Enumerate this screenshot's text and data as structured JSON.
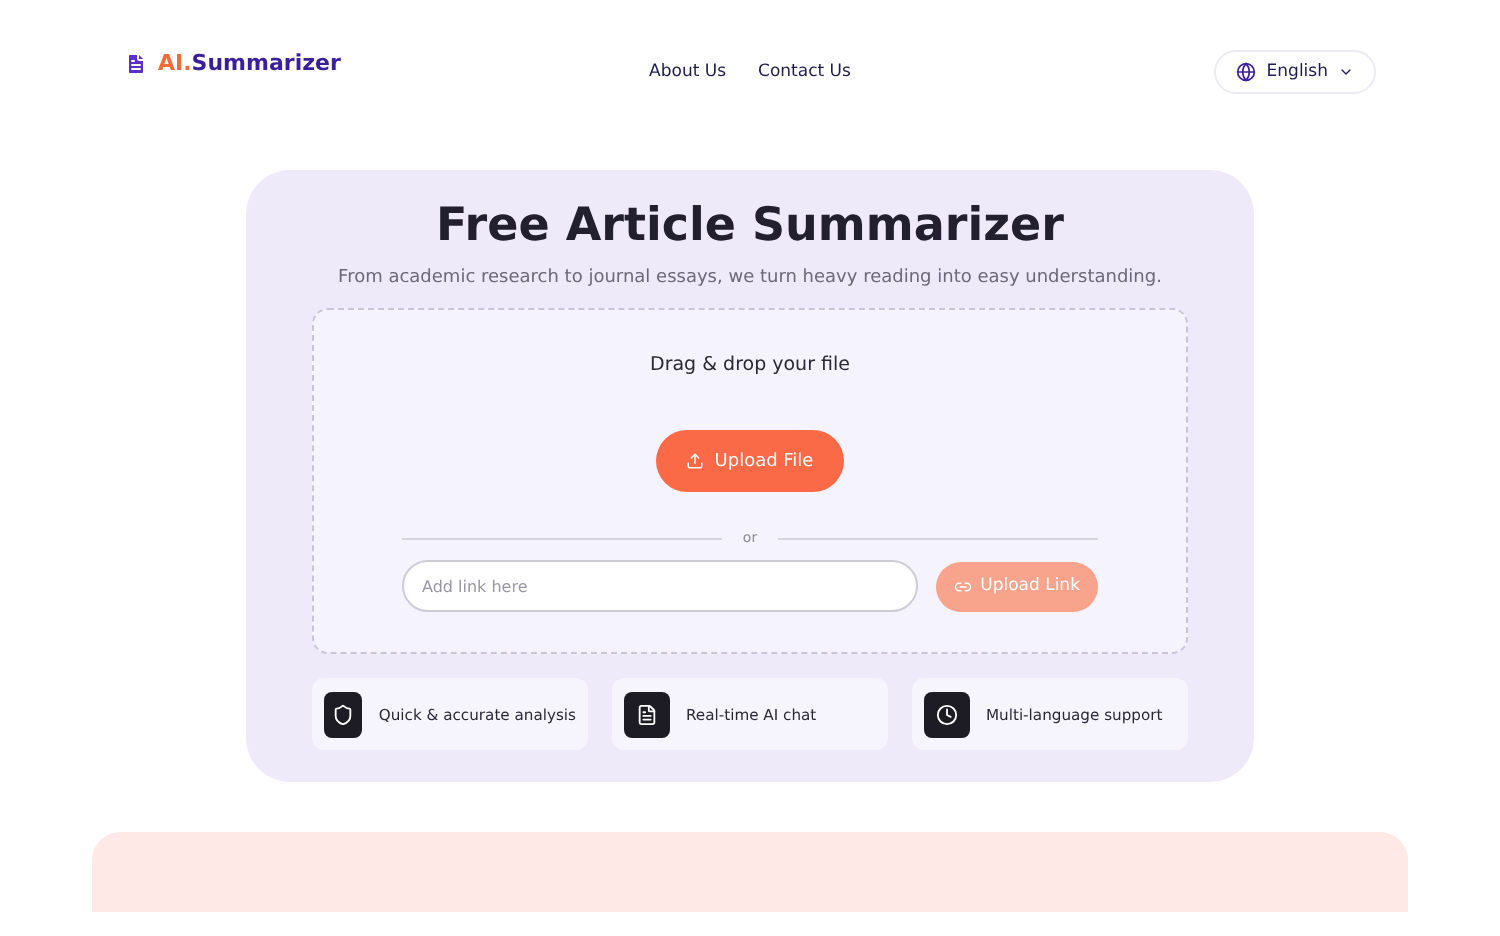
{
  "logo": {
    "prefix": "AI.",
    "name": "Summarizer"
  },
  "nav": [
    {
      "label": "About Us"
    },
    {
      "label": "Contact Us"
    }
  ],
  "language": {
    "label": "English"
  },
  "hero": {
    "title": "Free Article Summarizer",
    "subtitle": "From academic research to journal essays, we turn heavy reading into easy understanding."
  },
  "dropzone": {
    "prompt": "Drag & drop your file",
    "upload_button": "Upload File",
    "divider": "or",
    "link_field": {
      "placeholder": "Add link here"
    },
    "link_button": {
      "label": "Upload Link",
      "disabled": true
    }
  },
  "features": [
    {
      "kind": "shield",
      "label": "Quick & accurate analysis"
    },
    {
      "kind": "document",
      "label": "Real-time AI chat"
    },
    {
      "kind": "clock",
      "label": "Multi-language support"
    }
  ]
}
